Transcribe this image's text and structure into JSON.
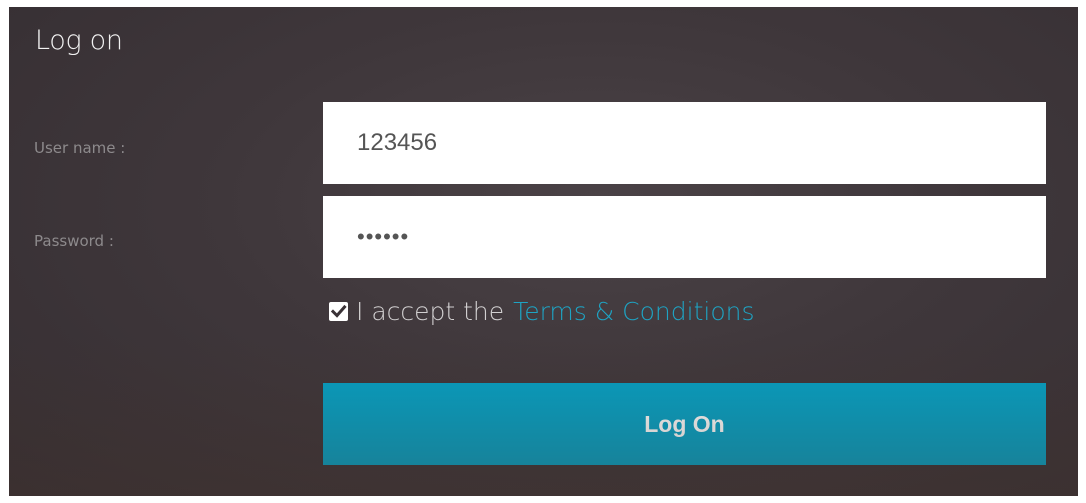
{
  "form": {
    "title": "Log on",
    "username_label": "User name :",
    "username_value": "123456",
    "password_label": "Password :",
    "password_value": "••••••",
    "accept_checked": true,
    "accept_prefix": "I accept the",
    "terms_link": "Terms & Conditions",
    "submit_label": "Log On"
  },
  "colors": {
    "accent": "#04a2c6",
    "link": "#1ea4c4",
    "panel_background": "#3f373b"
  },
  "icons": {
    "checkbox": "checked-checkbox-icon"
  }
}
